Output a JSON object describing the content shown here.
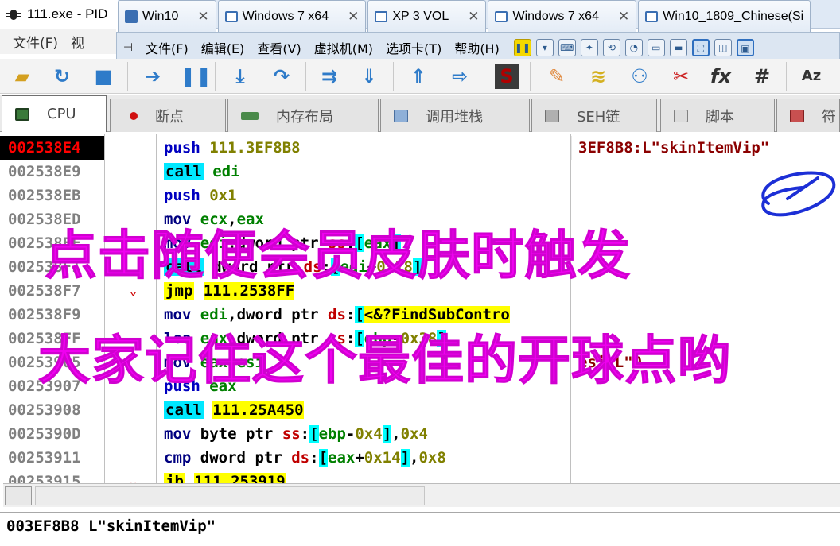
{
  "window": {
    "app_title": "111.exe - PID",
    "menu_left": [
      "文件(F)",
      "视"
    ]
  },
  "vm_tabs": [
    {
      "label": "Win10",
      "icon": "home-icon"
    },
    {
      "label": "Windows 7 x64",
      "icon": "vm-icon"
    },
    {
      "label": "XP 3 VOL",
      "icon": "vm-icon"
    },
    {
      "label": "Windows 7 x64",
      "icon": "vm-icon"
    },
    {
      "label": "Win10_1809_Chinese(Si",
      "icon": "vm-icon"
    }
  ],
  "vm_menu": [
    "文件(F)",
    "编辑(E)",
    "查看(V)",
    "虚拟机(M)",
    "选项卡(T)",
    "帮助(H)"
  ],
  "debugger_tabs": [
    {
      "label": "CPU",
      "active": true
    },
    {
      "label": "断点",
      "active": false
    },
    {
      "label": "内存布局",
      "active": false
    },
    {
      "label": "调用堆栈",
      "active": false
    },
    {
      "label": "SEH链",
      "active": false
    },
    {
      "label": "脚本",
      "active": false
    },
    {
      "label": "符",
      "active": false
    }
  ],
  "disasm": {
    "current_address": "002538E4",
    "rows": [
      {
        "addr": "002538E4",
        "mn": "push",
        "ops": "111.3EF8B8",
        "comment": "3EF8B8:L\"skinItemVip\""
      },
      {
        "addr": "002538E9",
        "mn": "call",
        "ops": "edi"
      },
      {
        "addr": "002538EB",
        "mn": "push",
        "ops": "0x1"
      },
      {
        "addr": "002538ED",
        "mn": "mov",
        "ops": "ecx,eax"
      },
      {
        "addr": "002538EF",
        "mn": "mov",
        "ops": "edi,dword ptr ss:[eax]"
      },
      {
        "addr": "002538F1",
        "mn": "call",
        "ops": "dword ptr ds:[edi+0x18]"
      },
      {
        "addr": "002538F7",
        "mn": "jmp",
        "ops": "111.2538FF",
        "arrow": "⌄"
      },
      {
        "addr": "002538F9",
        "mn": "mov",
        "ops": "edi,dword ptr ds:[<&?FindSubContro"
      },
      {
        "addr": "002538FF",
        "mn": "lea",
        "ops": "eax,dword ptr ss:[ebp-0x38]"
      },
      {
        "addr": "00253905",
        "mn": "mov",
        "ops": "eax,esi",
        "comment": "esi:L\"0"
      },
      {
        "addr": "00253907",
        "mn": "push",
        "ops": "eax"
      },
      {
        "addr": "00253908",
        "mn": "call",
        "ops": "111.25A450"
      },
      {
        "addr": "0025390D",
        "mn": "mov",
        "ops": "byte ptr ss:[ebp-0x4],0x4"
      },
      {
        "addr": "00253911",
        "mn": "cmp",
        "ops": "dword ptr ds:[eax+0x14],0x8"
      },
      {
        "addr": "00253915",
        "mn": "jb",
        "ops": "111.253919",
        "arrow": "⌄"
      }
    ]
  },
  "infobar": {
    "text": "003EF8B8 L\"skinItemVip\""
  },
  "overlay": {
    "line1": "点击随便会员皮肤时触发",
    "line2": "大家记住这个最佳的开球点哟"
  },
  "colors": {
    "overlay_text": "#f000f0",
    "current_addr_bg": "#000000",
    "current_addr_fg": "#ff0000",
    "call_highlight": "#00e8ff",
    "jmp_highlight": "#ffff00",
    "scribble": "#1c2fd6"
  }
}
